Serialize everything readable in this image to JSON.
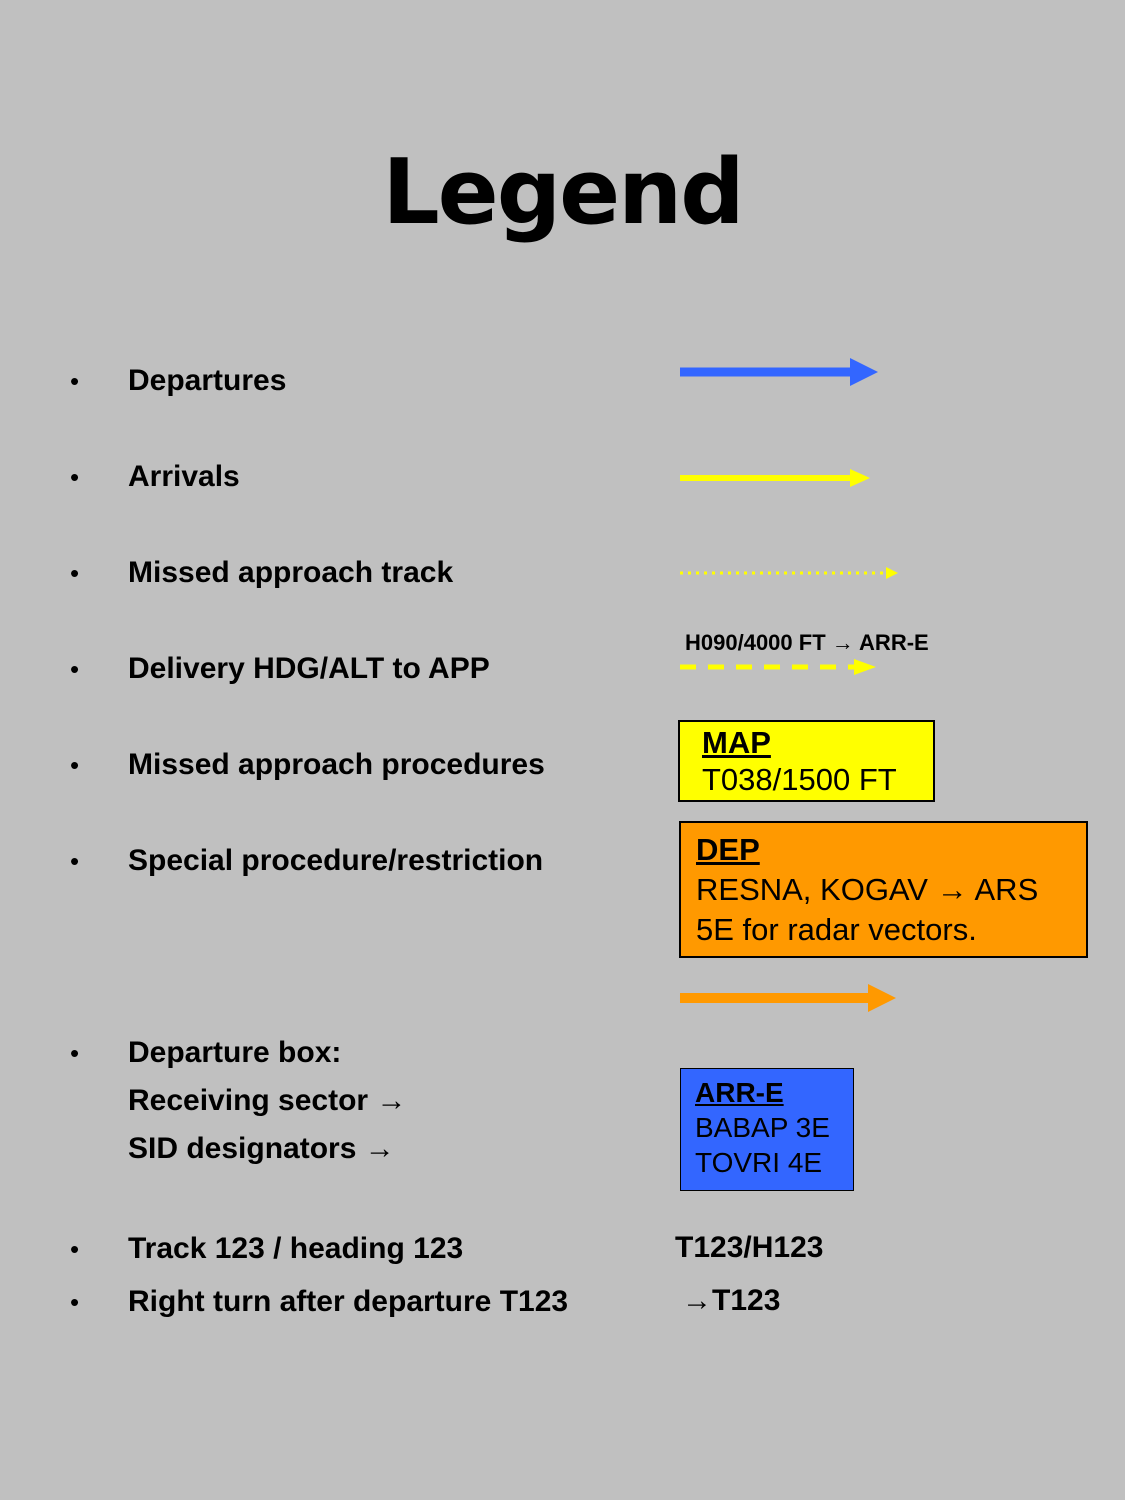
{
  "title": "Legend",
  "bullet_char": "•",
  "items": [
    {
      "label": "Departures"
    },
    {
      "label": "Arrivals"
    },
    {
      "label": "Missed approach track"
    },
    {
      "label": "Delivery HDG/ALT to APP"
    },
    {
      "label": "Missed approach procedures"
    },
    {
      "label": "Special procedure/restriction"
    },
    {
      "label_lines": [
        "Departure box:",
        "Receiving sector →",
        "SID designators →"
      ]
    },
    {
      "label": "Track 123 / heading 123"
    },
    {
      "label": "Right turn after departure T123"
    }
  ],
  "delivery_label": "H090/4000 FT → ARR-E",
  "map_box": {
    "title": "MAP",
    "line1": "T038/1500 FT"
  },
  "dep_box": {
    "title": "DEP",
    "line1": "RESNA, KOGAV → ARS",
    "line2": "5E for radar vectors."
  },
  "arr_box": {
    "title": "ARR-E",
    "line1": "BABAP 3E",
    "line2": "TOVRI 4E"
  },
  "track_code": "T123/H123",
  "turn_code": "→T123",
  "colors": {
    "background": "#c0c0c0",
    "departure_blue": "#3366ff",
    "arrival_yellow": "#ffff00",
    "special_orange": "#ff9900"
  }
}
